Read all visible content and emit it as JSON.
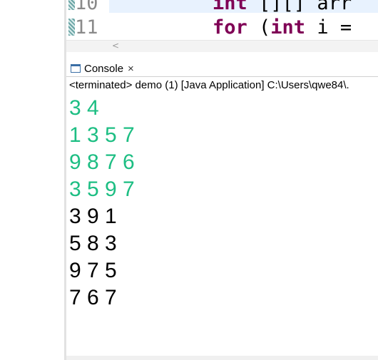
{
  "editor": {
    "lines": [
      {
        "number": "10",
        "tokens": [
          {
            "text": "int",
            "kw": true
          },
          {
            "text": " [][] arr",
            "kw": false
          }
        ]
      },
      {
        "number": "11",
        "tokens": [
          {
            "text": "for",
            "kw": true
          },
          {
            "text": " (",
            "kw": false
          },
          {
            "text": "int",
            "kw": true
          },
          {
            "text": " i =",
            "kw": false
          }
        ]
      }
    ],
    "scroll_left_arrow": "<"
  },
  "console": {
    "tab_label": "Console",
    "tab_close": "×",
    "status": "<terminated> demo (1) [Java Application] C:\\Users\\qwe84\\.",
    "input_lines": [
      "3 4",
      "1 3 5 7",
      "9 8 7 6",
      "3 5 9 7"
    ],
    "output_lines": [
      "3 9 1",
      "5 8 3",
      "9 7 5",
      "7 6 7"
    ],
    "colors": {
      "input": "#1dbe83",
      "output": "#000000",
      "keyword": "#7f0055"
    }
  }
}
